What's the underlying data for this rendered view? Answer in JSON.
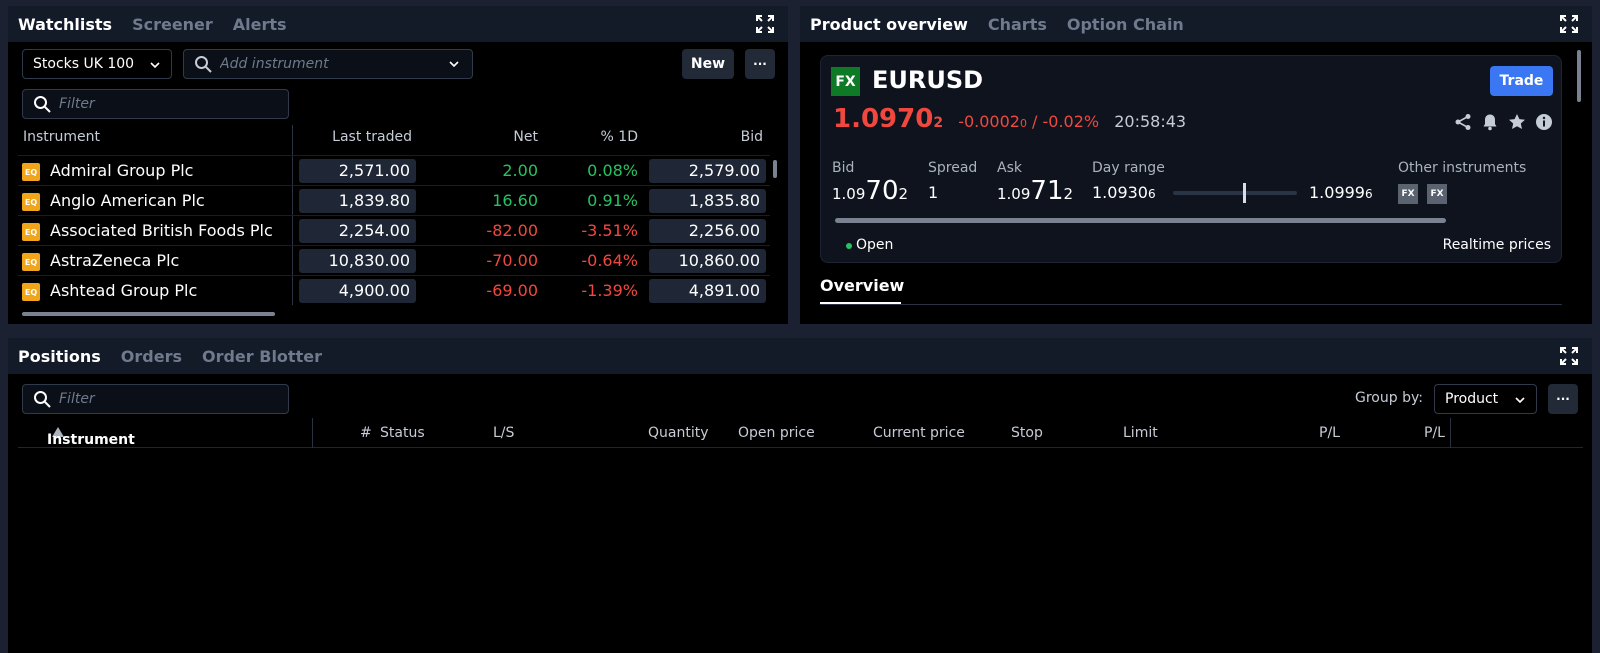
{
  "watchlists": {
    "tabs": [
      "Watchlists",
      "Screener",
      "Alerts"
    ],
    "list_select": "Stocks UK 100",
    "add_instrument_placeholder": "Add instrument",
    "new_label": "New",
    "more_label": "···",
    "filter_placeholder": "Filter",
    "columns": [
      "Instrument",
      "Last traded",
      "Net",
      "% 1D",
      "Bid"
    ],
    "rows": [
      {
        "badge": "EQ",
        "name": "Admiral Group Plc",
        "last": "2,571.00",
        "net": "2.00",
        "pct": "0.08%",
        "bid": "2,579.00",
        "dir": "up"
      },
      {
        "badge": "EQ",
        "name": "Anglo American Plc",
        "last": "1,839.80",
        "net": "16.60",
        "pct": "0.91%",
        "bid": "1,835.80",
        "dir": "up"
      },
      {
        "badge": "EQ",
        "name": "Associated British Foods Plc",
        "last": "2,254.00",
        "net": "-82.00",
        "pct": "-3.51%",
        "bid": "2,256.00",
        "dir": "down"
      },
      {
        "badge": "EQ",
        "name": "AstraZeneca Plc",
        "last": "10,830.00",
        "net": "-70.00",
        "pct": "-0.64%",
        "bid": "10,860.00",
        "dir": "down"
      },
      {
        "badge": "EQ",
        "name": "Ashtead Group Plc",
        "last": "4,900.00",
        "net": "-69.00",
        "pct": "-1.39%",
        "bid": "4,891.00",
        "dir": "down"
      }
    ]
  },
  "product": {
    "tabs": [
      "Product overview",
      "Charts",
      "Option Chain"
    ],
    "badge": "FX",
    "symbol": "EURUSD",
    "trade_label": "Trade",
    "price_main": "1.0970",
    "price_sub": "2",
    "change_main": "-0.0002",
    "change_sub": "0",
    "change_pct": " / -0.02%",
    "time": "20:58:43",
    "bid_label": "Bid",
    "bid_pre": "1.09",
    "bid_big": "70",
    "bid_sub": "2",
    "spread_label": "Spread",
    "spread_value": "1",
    "ask_label": "Ask",
    "ask_pre": "1.09",
    "ask_big": "71",
    "ask_sub": "2",
    "day_range_label": "Day range",
    "day_low_main": "1.0930",
    "day_low_sub": "6",
    "day_high_main": "1.0999",
    "day_high_sub": "6",
    "day_range_position": 0.58,
    "other_label": "Other instruments",
    "other_badge": "FX",
    "status": "Open",
    "realtime_label": "Realtime prices",
    "overview_tab": "Overview"
  },
  "positions": {
    "tabs": [
      "Positions",
      "Orders",
      "Order Blotter"
    ],
    "filter_placeholder": "Filter",
    "group_by_label": "Group by:",
    "group_by_value": "Product",
    "more_label": "···",
    "col_instrument": "Instrument",
    "col_count": "#",
    "col_status": "Status",
    "col_ls": "L/S",
    "col_quantity": "Quantity",
    "col_open": "Open price",
    "col_current": "Current price",
    "col_stop": "Stop",
    "col_limit": "Limit",
    "col_pl1": "P/L",
    "col_pl2": "P/L"
  },
  "colors": {
    "positive": "#27c360",
    "negative": "#f0483e",
    "accent": "#3b76f3",
    "eq_badge": "#f0a51b",
    "fx_badge": "#0e7a26"
  }
}
